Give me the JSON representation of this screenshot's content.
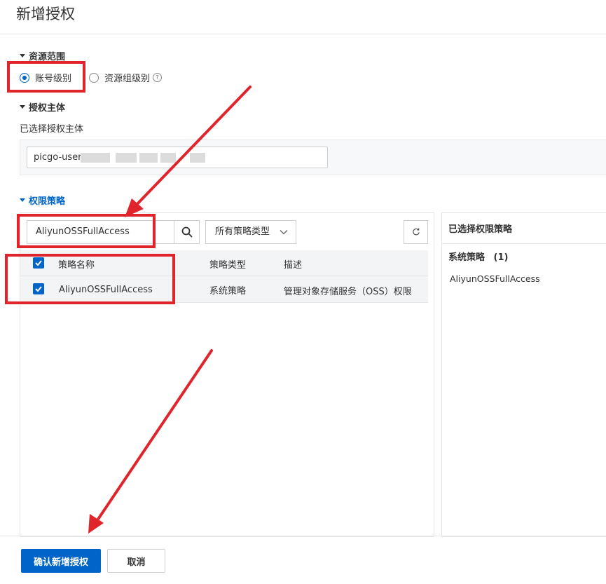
{
  "page": {
    "title": "新增授权"
  },
  "resource_scope": {
    "heading": "资源范围",
    "options": [
      {
        "label": "账号级别",
        "checked": true
      },
      {
        "label": "资源组级别",
        "checked": false
      }
    ],
    "help_icon": "question-circle-icon"
  },
  "principal": {
    "heading": "授权主体",
    "selected_label": "已选择授权主体",
    "value": "picgo-user-"
  },
  "policy": {
    "heading": "权限策略",
    "search_value": "AliyunOSSFullAccess",
    "type_select": "所有策略类型",
    "columns": [
      "策略名称",
      "策略类型",
      "描述"
    ],
    "rows": [
      {
        "name": "AliyunOSSFullAccess",
        "type": "系统策略",
        "desc": "管理对象存储服务（OSS）权限",
        "checked": true
      }
    ]
  },
  "selected_panel": {
    "title": "已选择权限策略",
    "group_label": "系统策略",
    "group_count": "(1)",
    "items": [
      "AliyunOSSFullAccess"
    ]
  },
  "footer": {
    "confirm_label": "确认新增授权",
    "cancel_label": "取消"
  },
  "colors": {
    "accent": "#0064c8",
    "annotation": "#e0242b"
  }
}
